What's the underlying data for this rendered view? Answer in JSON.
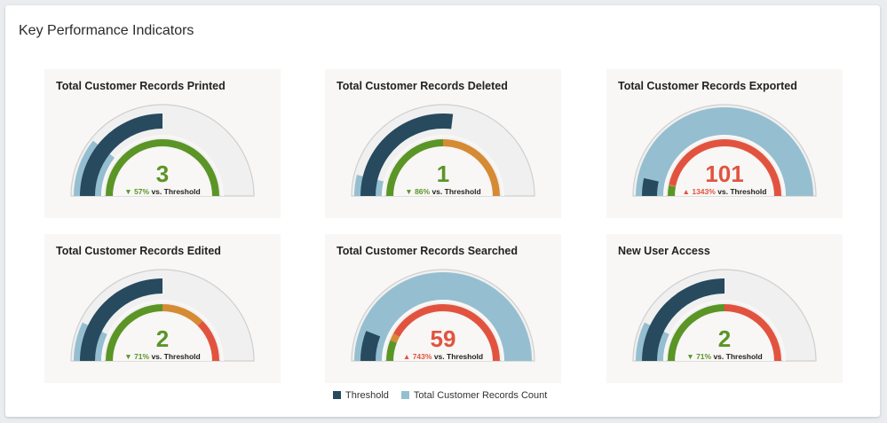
{
  "header": {
    "title": "Key Performance Indicators"
  },
  "colors": {
    "threshold": "#274a5e",
    "count": "#95bfd0",
    "green": "#5a9526",
    "orange": "#d68a34",
    "red": "#e2533f",
    "track": "#f0f0f0"
  },
  "legend": {
    "threshold": "Threshold",
    "count": "Total Customer Records Count"
  },
  "chart_data": [
    {
      "type": "gauge",
      "title": "Total Customer Records Printed",
      "value": 3,
      "value_label": "3",
      "threshold": 7,
      "max": 14,
      "direction": "down",
      "pct": "57%",
      "vs": "vs. Threshold",
      "status": "green",
      "segments": [
        {
          "from": 0,
          "to": 14,
          "color": "green"
        }
      ]
    },
    {
      "type": "gauge",
      "title": "Total Customer Records Deleted",
      "value": 1,
      "value_label": "1",
      "threshold": 7,
      "max": 13,
      "direction": "down",
      "pct": "86%",
      "vs": "vs. Threshold",
      "status": "green",
      "segments": [
        {
          "from": 0,
          "to": 6.5,
          "color": "green"
        },
        {
          "from": 6.5,
          "to": 13,
          "color": "orange"
        }
      ]
    },
    {
      "type": "gauge",
      "title": "Total Customer Records Exported",
      "value": 101,
      "value_label": "101",
      "threshold": 7,
      "max": 101,
      "direction": "up",
      "pct": "1343%",
      "vs": "vs. Threshold",
      "status": "red",
      "segments": [
        {
          "from": 0,
          "to": 6,
          "color": "green"
        },
        {
          "from": 6,
          "to": 6.5,
          "color": "orange"
        },
        {
          "from": 6.5,
          "to": 101,
          "color": "red"
        }
      ]
    },
    {
      "type": "gauge",
      "title": "Total Customer Records Edited",
      "value": 2,
      "value_label": "2",
      "threshold": 7,
      "max": 14,
      "direction": "down",
      "pct": "71%",
      "vs": "vs. Threshold",
      "status": "green",
      "segments": [
        {
          "from": 0,
          "to": 7,
          "color": "green"
        },
        {
          "from": 7,
          "to": 10.5,
          "color": "orange"
        },
        {
          "from": 10.5,
          "to": 14,
          "color": "red"
        }
      ]
    },
    {
      "type": "gauge",
      "title": "Total Customer Records Searched",
      "value": 59,
      "value_label": "59",
      "threshold": 7,
      "max": 59,
      "direction": "up",
      "pct": "743%",
      "vs": "vs. Threshold",
      "status": "red",
      "segments": [
        {
          "from": 0,
          "to": 7,
          "color": "green"
        },
        {
          "from": 7,
          "to": 9.5,
          "color": "orange"
        },
        {
          "from": 9.5,
          "to": 59,
          "color": "red"
        }
      ]
    },
    {
      "type": "gauge",
      "title": "New User Access",
      "value": 2,
      "value_label": "2",
      "threshold": 7,
      "max": 14,
      "direction": "down",
      "pct": "71%",
      "vs": "vs. Threshold",
      "status": "green",
      "segments": [
        {
          "from": 0,
          "to": 7,
          "color": "green"
        },
        {
          "from": 7,
          "to": 14,
          "color": "red"
        }
      ]
    }
  ]
}
